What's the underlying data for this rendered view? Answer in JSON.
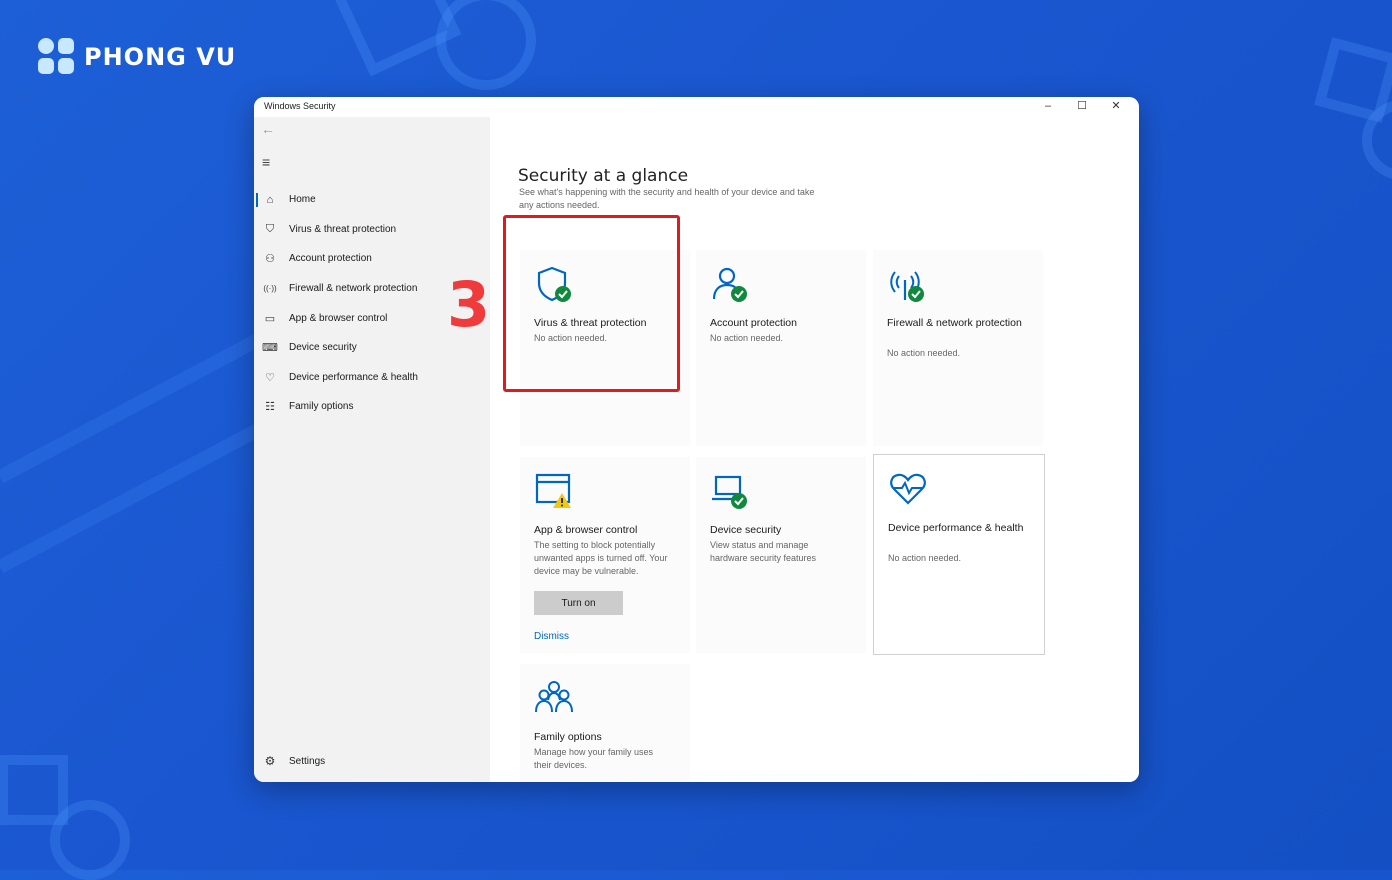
{
  "brand": {
    "logo_text": "PHONG VU",
    "logo_color": "#c8e8ff"
  },
  "window": {
    "title": "Windows Security",
    "controls": {
      "minimize": "–",
      "maximize": "☐",
      "close": "✕"
    }
  },
  "sidebar": {
    "back_icon": "back-arrow-icon",
    "menu_icon": "hamburger-icon",
    "items": [
      {
        "label": "Home",
        "icon": "home-icon",
        "glyph": "⌂",
        "active": true
      },
      {
        "label": "Virus & threat protection",
        "icon": "shield-icon",
        "glyph": "⛉"
      },
      {
        "label": "Account protection",
        "icon": "person-icon",
        "glyph": "⚇"
      },
      {
        "label": "Firewall & network protection",
        "icon": "wireless-icon",
        "glyph": "((·))"
      },
      {
        "label": "App & browser control",
        "icon": "browser-window-icon",
        "glyph": "▭"
      },
      {
        "label": "Device security",
        "icon": "laptop-icon",
        "glyph": "⌨"
      },
      {
        "label": "Device performance & health",
        "icon": "heart-icon",
        "glyph": "♡"
      },
      {
        "label": "Family options",
        "icon": "family-icon",
        "glyph": "☷"
      }
    ],
    "settings_label": "Settings",
    "settings_icon": "gear-icon"
  },
  "main": {
    "title": "Security at a glance",
    "subtitle": "See what's happening with the security and health of your device and take any actions needed."
  },
  "tiles": {
    "virus": {
      "title": "Virus & threat protection",
      "desc": "No action needed."
    },
    "account": {
      "title": "Account protection",
      "desc": "No action needed."
    },
    "firewall": {
      "title": "Firewall & network protection",
      "desc": "No action needed."
    },
    "app": {
      "title": "App & browser control",
      "desc": "The setting to block potentially unwanted apps is turned off. Your device may be vulnerable.",
      "button": "Turn on",
      "link": "Dismiss"
    },
    "device": {
      "title": "Device security",
      "desc": "View status and manage hardware security features"
    },
    "performance": {
      "title": "Device performance & health",
      "desc": "No action needed."
    },
    "family": {
      "title": "Family options",
      "desc": "Manage how your family uses their devices."
    }
  },
  "annotation": {
    "step": "3",
    "color": "#e11b1b"
  },
  "colors": {
    "accent": "#0067c0",
    "ok_green": "#10893e",
    "warn_yellow": "#f2c811",
    "icon_blue": "#0067c0"
  }
}
